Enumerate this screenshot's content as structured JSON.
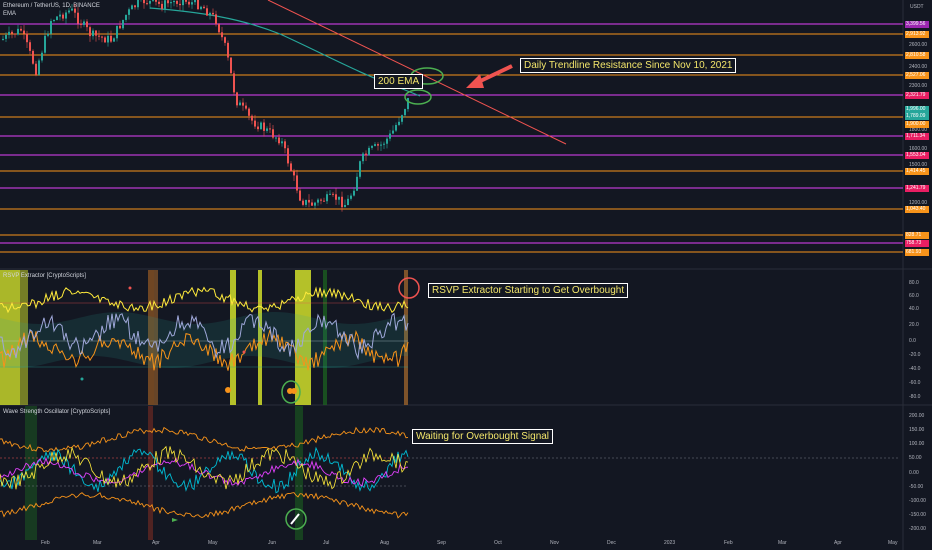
{
  "header": {
    "symbol": "Ethereum / TetherUS, 1D, BINANCE",
    "indicator": "EMA",
    "currency": "USDT"
  },
  "price_axis": {
    "ticks": [
      "2600.00",
      "2400.00",
      "2300.00",
      "1800.00",
      "1600.00",
      "1500.00",
      "1200.00"
    ],
    "tags": [
      {
        "text": "3,399.56",
        "color": "#9c27b0"
      },
      {
        "text": "2,913.92",
        "color": "#f7931a"
      },
      {
        "text": "2,810.58",
        "color": "#f7931a"
      },
      {
        "text": "2,527.06",
        "color": "#f7931a"
      },
      {
        "text": "2,321.79",
        "color": "#e91e63"
      },
      {
        "text": "1,996.00",
        "color": "#26a69a"
      },
      {
        "text": "1,789.09",
        "color": "#26a69a"
      },
      {
        "text": "1,900.00",
        "color": "#f7931a"
      },
      {
        "text": "1,711.34",
        "color": "#e91e63"
      },
      {
        "text": "1,553.04",
        "color": "#e91e63"
      },
      {
        "text": "1,414.45",
        "color": "#f7931a"
      },
      {
        "text": "1,241.79",
        "color": "#e91e63"
      },
      {
        "text": "1,043.40",
        "color": "#f7931a"
      },
      {
        "text": "828.71",
        "color": "#f7931a"
      },
      {
        "text": "758.73",
        "color": "#e91e63"
      },
      {
        "text": "681.93",
        "color": "#f7931a"
      }
    ]
  },
  "rsvp": {
    "title": "RSVP Extractor [CryptoScripts]",
    "ticks": [
      "80.0",
      "60.0",
      "40.0",
      "20.0",
      "0.0",
      "-20.0",
      "-40.0",
      "-60.0",
      "-80.0"
    ]
  },
  "wave": {
    "title": "Wave Strength Oscillator [CryptoScripts]",
    "ticks": [
      "200.00",
      "150.00",
      "100.00",
      "50.00",
      "0.00",
      "-50.00",
      "-100.00",
      "-150.00",
      "-200.00"
    ]
  },
  "time_axis": [
    "Feb",
    "Mar",
    "Apr",
    "May",
    "Jun",
    "Jul",
    "Aug",
    "Sep",
    "Oct",
    "Nov",
    "Dec",
    "2023",
    "Feb",
    "Mar",
    "Apr",
    "May"
  ],
  "annotations": {
    "trendline": "Daily Trendline Resistance Since Nov 10, 2021",
    "ema": "200 EMA",
    "rsvp": "RSVP Extractor Starting to Get Overbought",
    "wave": "Waiting for Overbought Signal"
  },
  "colors": {
    "background": "#131722",
    "annotation_text": "#f3e66b",
    "orange_level": "#f7931a",
    "magenta_level": "#e040fb",
    "trendline": "#f44336",
    "ema": "#26a69a",
    "highlight_circle": "#4caf50"
  }
}
